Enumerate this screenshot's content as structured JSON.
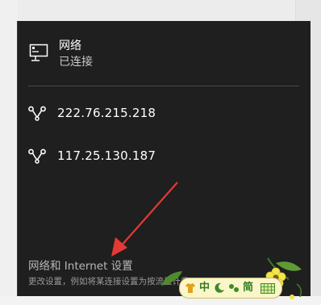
{
  "network": {
    "title": "网络",
    "status": "已连接",
    "icon": "monitor-network-icon"
  },
  "connections": [
    {
      "address": "222.76.215.218",
      "icon": "dialup-link-icon"
    },
    {
      "address": "117.25.130.187",
      "icon": "dialup-link-icon"
    }
  ],
  "settings": {
    "link_label": "网络和 Internet 设置",
    "description": "更改设置，例如将某连接设置为按流量计费。"
  },
  "ime": {
    "mode_label": "中",
    "simplified_label": "简",
    "icons": [
      "shirt-icon",
      "moon-icon",
      "punctuation-icon",
      "keyboard-icon",
      "flower-icon"
    ]
  },
  "colors": {
    "flyout_bg": "#1f1f1f",
    "annotation_arrow": "#e53935",
    "ime_bg": "#fbf6c9"
  }
}
